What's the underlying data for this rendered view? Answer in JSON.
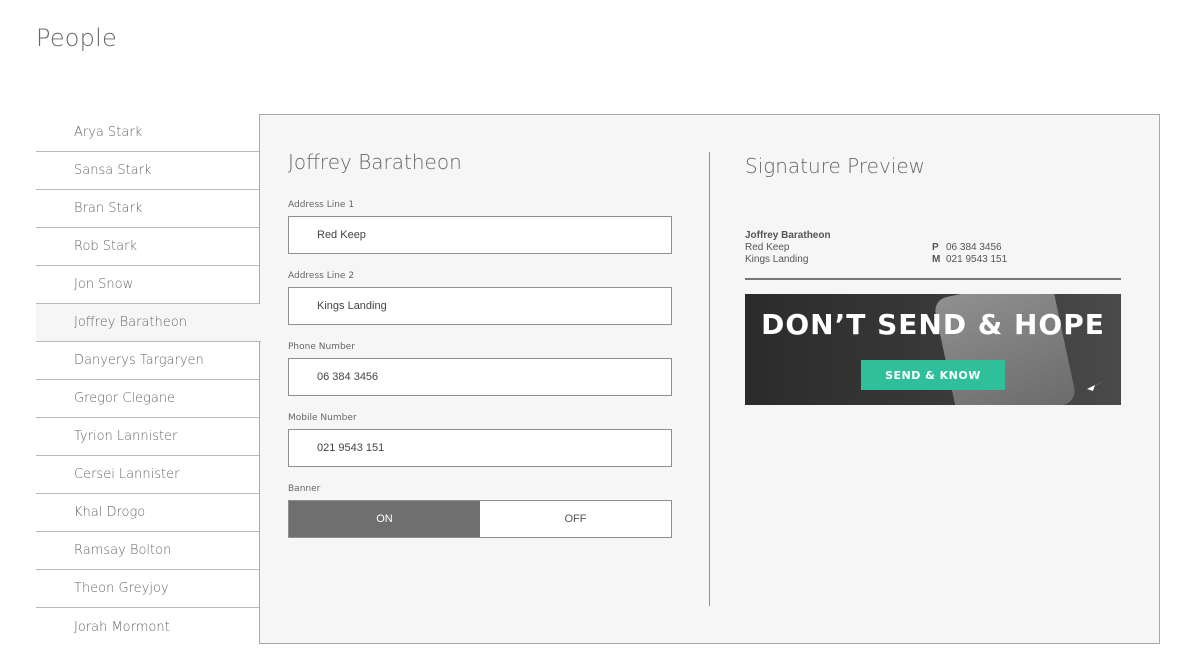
{
  "page": {
    "title": "People"
  },
  "people": [
    "Arya Stark",
    "Sansa Stark",
    "Bran Stark",
    "Rob Stark",
    "Jon Snow",
    "Joffrey Baratheon",
    "Danyerys Targaryen",
    "Gregor Clegane",
    "Tyrion Lannister",
    "Cersei Lannister",
    "Khal Drogo",
    "Ramsay Bolton",
    "Theon Greyjoy",
    "Jorah Mormont"
  ],
  "selected_person": "Joffrey Baratheon",
  "form": {
    "name": "Joffrey Baratheon",
    "address1_label": "Address Line 1",
    "address1_value": "Red Keep",
    "address2_label": "Address Line 2",
    "address2_value": "Kings Landing",
    "phone_label": "Phone Number",
    "phone_value": "06 384 3456",
    "mobile_label": "Mobile Number",
    "mobile_value": "021 9543 151",
    "banner_label": "Banner",
    "banner_on": "ON",
    "banner_off": "OFF",
    "banner_state": "on"
  },
  "preview": {
    "title": "Signature Preview",
    "name": "Joffrey Baratheon",
    "address1": "Red Keep",
    "address2": "Kings Landing",
    "phone_prefix": "P",
    "phone": "06 384 3456",
    "mobile_prefix": "M",
    "mobile": "021 9543 151",
    "banner_headline": "DON’T SEND & HOPE",
    "banner_cta": "SEND & KNOW"
  },
  "colors": {
    "accent": "#2fbf9a",
    "toggle_on": "#6f6f6f",
    "panel_bg": "#f6f6f6",
    "border": "#a9a9a9"
  }
}
